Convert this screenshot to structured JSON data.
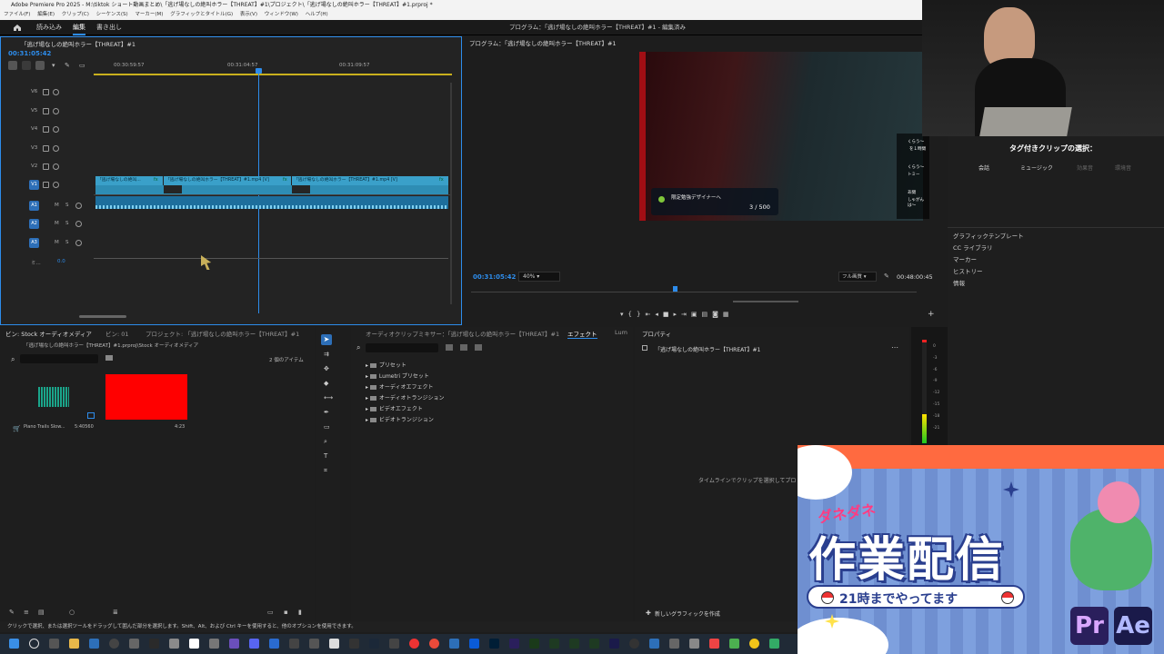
{
  "window": {
    "title": "Adobe Premiere Pro 2025 - M:\\tiktok ショート動画まとめ\\「逃げ場なしの絶叫ホラー【THREAT】#1\\プロジェクト\\「逃げ場なしの絶叫ホラー【THREAT】#1.prproj *"
  },
  "menu": [
    "ファイル(F)",
    "編集(E)",
    "クリップ(C)",
    "シーケンス(S)",
    "マーカー(M)",
    "グラフィックとタイトル(G)",
    "表示(V)",
    "ウィンドウ(W)",
    "ヘルプ(H)"
  ],
  "workspaces": [
    "読み込み",
    "編集",
    "書き出し"
  ],
  "program_title": "プログラム：「逃げ場なしの絶叫ホラー【THREAT】#1 - 編集済み",
  "timeline": {
    "tab": "「逃げ場なしの絶叫ホラー【THREAT】#1",
    "timecode": "00:31:05:42",
    "ruler": [
      "00:30:59:57",
      "00:31:04:57",
      "00:31:09:57"
    ],
    "video_tracks": [
      "V6",
      "V5",
      "V4",
      "V3",
      "V2",
      "V1"
    ],
    "audio_tracks": [
      "A1",
      "A2",
      "A3"
    ],
    "mix_label": "ミ...",
    "mix_value": "0.0",
    "clips": [
      "「逃げ場なしの絶叫...",
      "「逃げ場なしの絶叫ホラー【THREAT】#1.mp4 [V]",
      "「逃げ場なしの絶叫ホラー【THREAT】#1.mp4 [V]"
    ],
    "fx": "fx",
    "track_btn_m": "M",
    "track_btn_s": "S"
  },
  "program": {
    "tab": "プログラム：「逃げ場なしの絶叫ホラー【THREAT】#1",
    "timecode": "00:31:05:42",
    "zoom": "40%",
    "quality": "フル画質",
    "duration": "00:48:00:45",
    "game_objective": "限定勉強デザイナーへ",
    "game_counter": "3 / 500",
    "chat": [
      "くらう〜",
      "を１時間",
      "くらう〜",
      "トミー",
      "あ間",
      "しゃがんは〜"
    ]
  },
  "bins": {
    "tabs": [
      "ビン: Stock オーディオメディア",
      "ビン: 01",
      "プロジェクト: 「逃げ場なしの絶叫ホラー【THREAT】#1"
    ],
    "path": "「逃げ場なしの絶叫ホラー【THREAT】#1.prproj\\Stock オーディオメディア",
    "count": "2 個のアイテム",
    "items": [
      {
        "name": "Piano Trails Slow...",
        "duration": "5:40560"
      },
      {
        "name": "",
        "duration": "4:23"
      }
    ]
  },
  "effects": {
    "tabs": [
      "オーディオクリップミキサー：「逃げ場なしの絶叫ホラー【THREAT】#1",
      "エフェクト",
      "Lum"
    ],
    "folders": [
      "プリセット",
      "Lumetri プリセット",
      "オーディオエフェクト",
      "オーディオトランジション",
      "ビデオエフェクト",
      "ビデオトランジション"
    ]
  },
  "properties": {
    "tab": "プロパティ",
    "sequence": "「逃げ場なしの絶叫ホラー【THREAT】#1",
    "empty_message": "タイムラインでクリップを選択してプロ",
    "new_graphic": "新しいグラフィックを作成"
  },
  "meter_scale": [
    "0",
    "-3",
    "-6",
    "-9",
    "-12",
    "-15",
    "-18",
    "-21"
  ],
  "right_panel": {
    "title": "タグ付きクリップの選択：",
    "filters": [
      "会話",
      "ミュージック",
      "効果音",
      "環境音"
    ],
    "sections": [
      "グラフィックテンプレート",
      "CC ライブラリ",
      "マーカー",
      "ヒストリー",
      "情報"
    ]
  },
  "status_text": "クリックで選択、または選択ツールをドラッグして囲んだ部分を選択します。Shift、Alt、および Ctrl キーを使用すると、他のオプションを使用できます。",
  "overlay": {
    "kana": "ダネダネ",
    "headline": "作業配信",
    "subline": "21時までやってます",
    "app_pr": "Pr",
    "app_ae": "Ae"
  },
  "colors": {
    "accent": "#2d8ceb",
    "clip_video": "#3aa0c9",
    "clip_audio": "#1d6e9c",
    "red_swatch": "#ff0000",
    "audio_thumb": "#1aa58a"
  }
}
